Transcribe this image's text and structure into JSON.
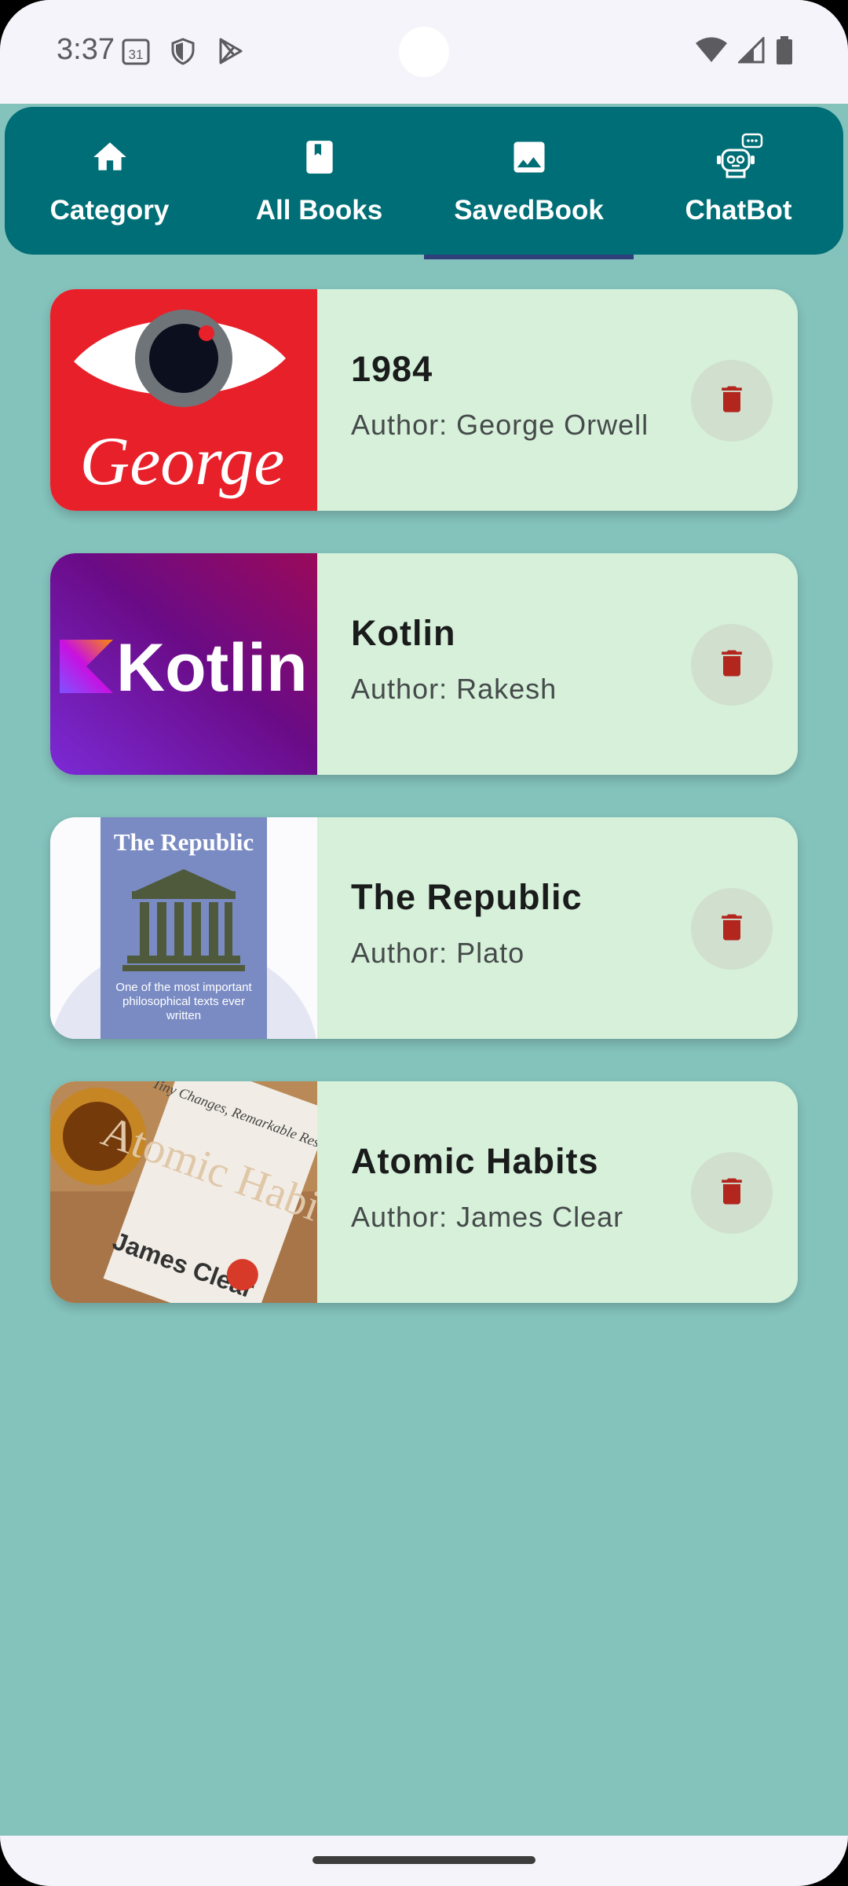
{
  "status_bar": {
    "time": "3:37",
    "calendar_day": "31",
    "left_icons": [
      "calendar-icon",
      "shield-icon",
      "play-store-icon"
    ],
    "right_icons": [
      "wifi-icon",
      "signal-icon",
      "battery-icon"
    ]
  },
  "tabs": [
    {
      "label": "Category",
      "icon": "home-icon",
      "active": false
    },
    {
      "label": "All Books",
      "icon": "book-icon",
      "active": false
    },
    {
      "label": "SavedBook",
      "icon": "image-icon",
      "active": true
    },
    {
      "label": "ChatBot",
      "icon": "robot-icon",
      "active": false
    }
  ],
  "books": [
    {
      "title": "1984",
      "author": "Author: George Orwell",
      "cover_text": "George"
    },
    {
      "title": "Kotlin",
      "author": "Author: Rakesh",
      "cover_text": "Kotlin"
    },
    {
      "title": "The Republic",
      "author": "Author: Plato",
      "cover_text": "The Republic",
      "cover_subtext": "One of the most important philosophical texts ever written"
    },
    {
      "title": "Atomic Habits",
      "author": "Author: James Clear",
      "cover_text": "Atomic Habits",
      "cover_subtext": "Tiny Changes, Remarkable Results",
      "cover_author": "James Clear"
    }
  ],
  "colors": {
    "background": "#84c2bc",
    "tab_bar": "#006e76",
    "card": "#d6f0da",
    "delete_icon": "#b3261e",
    "delete_bg": "#d1dfcf",
    "indicator": "#2e3f7a"
  }
}
